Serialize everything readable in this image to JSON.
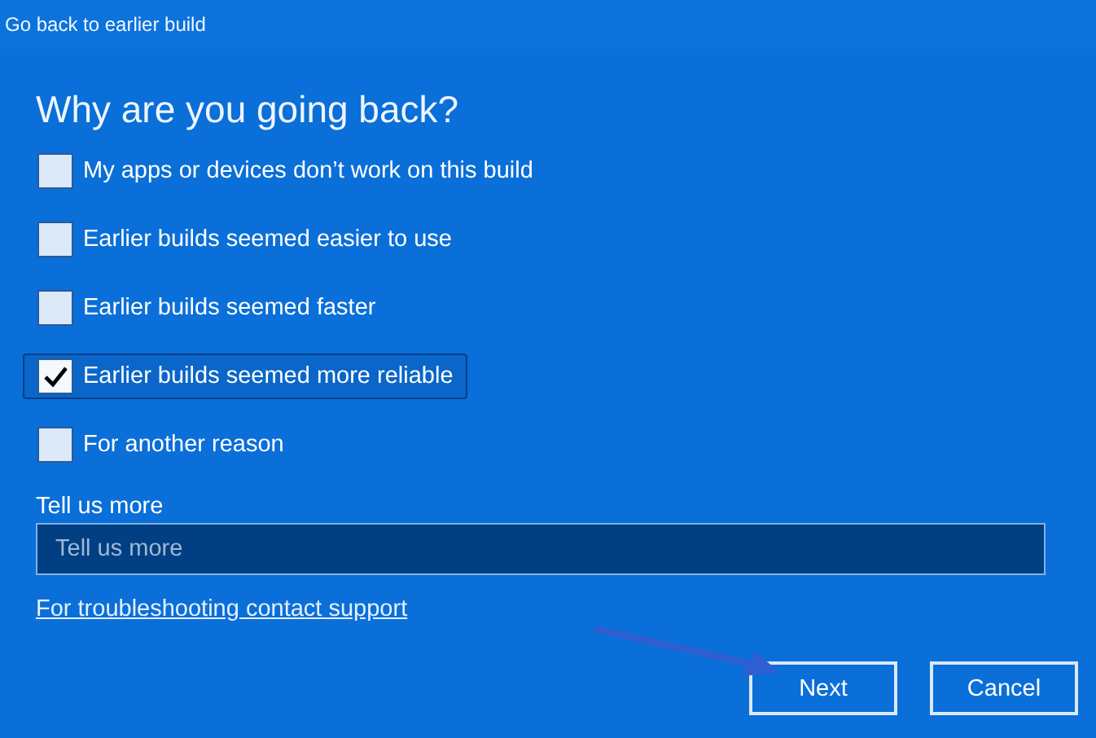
{
  "window": {
    "title": "Go back to earlier build"
  },
  "heading": "Why are you going back?",
  "reasons": [
    {
      "label": "My apps or devices don’t work on this build",
      "checked": false,
      "focused": false
    },
    {
      "label": "Earlier builds seemed easier to use",
      "checked": false,
      "focused": false
    },
    {
      "label": "Earlier builds seemed faster",
      "checked": false,
      "focused": false
    },
    {
      "label": "Earlier builds seemed more reliable",
      "checked": true,
      "focused": true
    },
    {
      "label": "For another reason",
      "checked": false,
      "focused": false
    }
  ],
  "details": {
    "label": "Tell us more",
    "placeholder": "Tell us more"
  },
  "support_link": "For troubleshooting contact support",
  "buttons": [
    "Next",
    "Cancel"
  ]
}
